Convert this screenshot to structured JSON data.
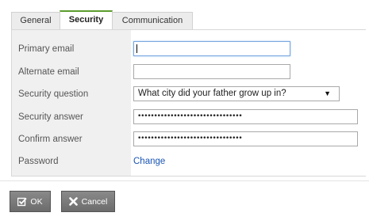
{
  "tabs": [
    {
      "label": "General",
      "active": false
    },
    {
      "label": "Security",
      "active": true
    },
    {
      "label": "Communication",
      "active": false
    }
  ],
  "form": {
    "primary_email": {
      "label": "Primary email",
      "value": ""
    },
    "alternate_email": {
      "label": "Alternate email",
      "value": ""
    },
    "security_question": {
      "label": "Security question",
      "value": "What city did your father grow up in?"
    },
    "security_answer": {
      "label": "Security answer",
      "masked": "••••••••••••••••••••••••••••••••"
    },
    "confirm_answer": {
      "label": "Confirm answer",
      "masked": "••••••••••••••••••••••••••••••••"
    },
    "password": {
      "label": "Password",
      "link": "Change"
    }
  },
  "buttons": {
    "ok": "OK",
    "cancel": "Cancel"
  },
  "colors": {
    "active_tab_accent": "#5c9d2d",
    "link": "#1a55b4",
    "focus_border": "#7aa7e0"
  },
  "icons": {
    "ok": "checkbox-check-icon",
    "cancel": "x-cross-icon",
    "select": "triangle-down-icon"
  }
}
